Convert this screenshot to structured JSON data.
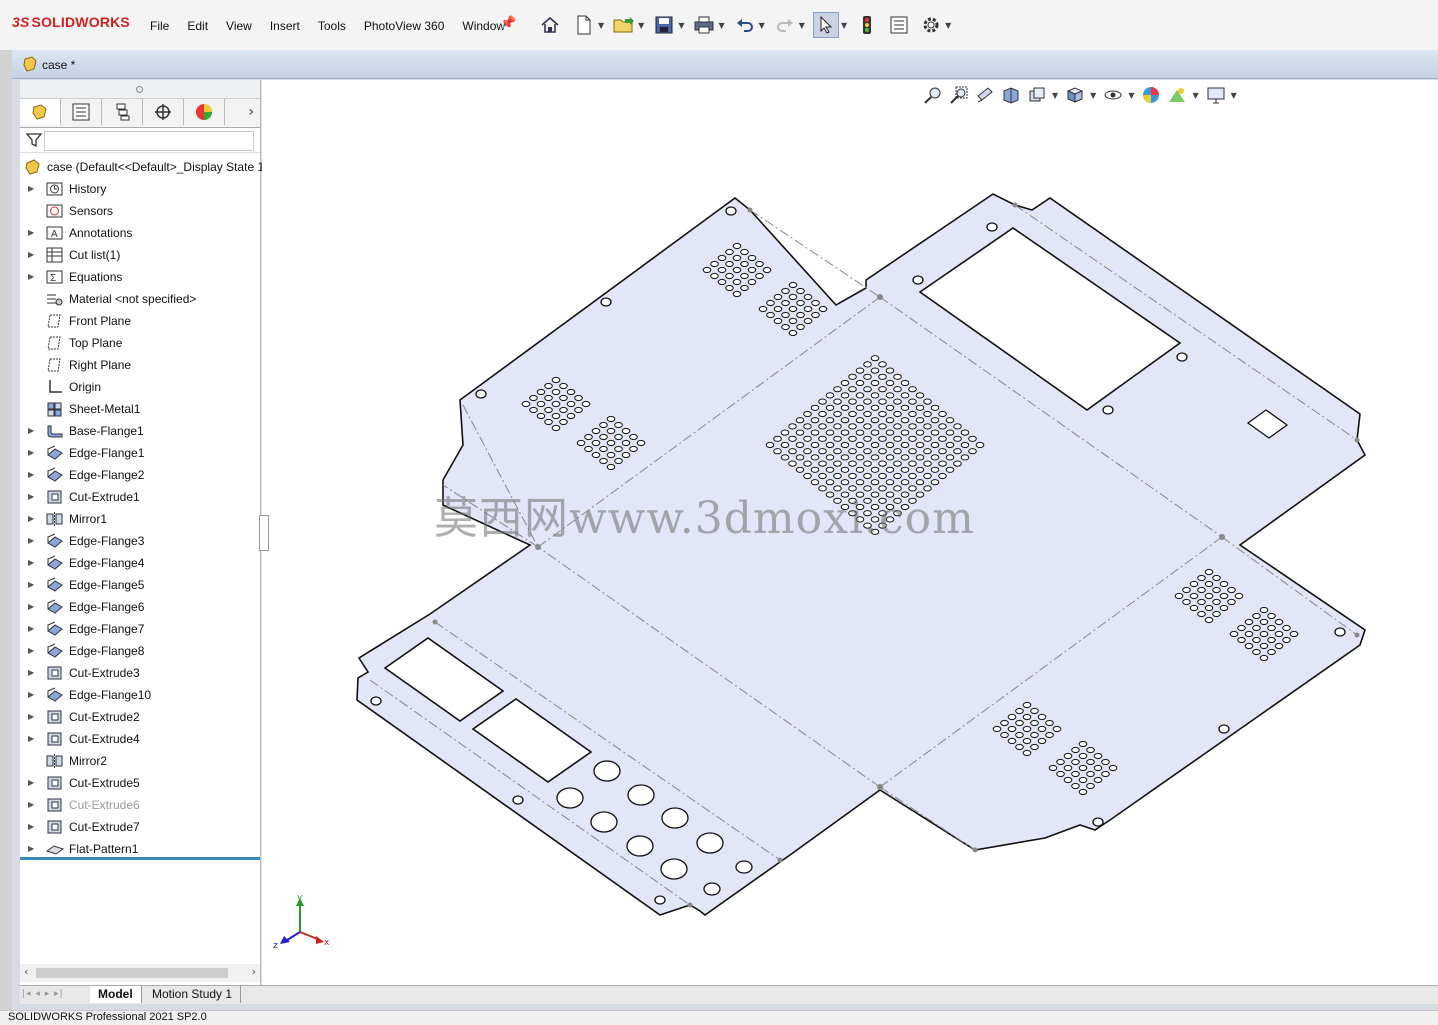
{
  "app": {
    "logo_prefix": "3S",
    "logo_name": "SOLIDWORKS"
  },
  "menu": [
    "File",
    "Edit",
    "View",
    "Insert",
    "Tools",
    "PhotoView 360",
    "Window"
  ],
  "document": {
    "title": "case *"
  },
  "tree": {
    "root_label": "case  (Default<<Default>_Display State 1",
    "items": [
      {
        "label": "History",
        "icon": "history-icon",
        "expandable": true,
        "dim": false
      },
      {
        "label": "Sensors",
        "icon": "sensor-icon",
        "expandable": false,
        "dim": false
      },
      {
        "label": "Annotations",
        "icon": "annotation-icon",
        "expandable": true,
        "dim": false
      },
      {
        "label": "Cut list(1)",
        "icon": "cutlist-icon",
        "expandable": true,
        "dim": false
      },
      {
        "label": "Equations",
        "icon": "equation-icon",
        "expandable": true,
        "dim": false
      },
      {
        "label": "Material <not specified>",
        "icon": "material-icon",
        "expandable": false,
        "dim": false
      },
      {
        "label": "Front Plane",
        "icon": "plane-icon",
        "expandable": false,
        "dim": false
      },
      {
        "label": "Top Plane",
        "icon": "plane-icon",
        "expandable": false,
        "dim": false
      },
      {
        "label": "Right Plane",
        "icon": "plane-icon",
        "expandable": false,
        "dim": false
      },
      {
        "label": "Origin",
        "icon": "origin-icon",
        "expandable": false,
        "dim": false
      },
      {
        "label": "Sheet-Metal1",
        "icon": "sheet-metal-icon",
        "expandable": false,
        "dim": false
      },
      {
        "label": "Base-Flange1",
        "icon": "base-flange-icon",
        "expandable": true,
        "dim": false
      },
      {
        "label": "Edge-Flange1",
        "icon": "edge-flange-icon",
        "expandable": true,
        "dim": false
      },
      {
        "label": "Edge-Flange2",
        "icon": "edge-flange-icon",
        "expandable": true,
        "dim": false
      },
      {
        "label": "Cut-Extrude1",
        "icon": "cut-extrude-icon",
        "expandable": true,
        "dim": false
      },
      {
        "label": "Mirror1",
        "icon": "mirror-icon",
        "expandable": true,
        "dim": false
      },
      {
        "label": "Edge-Flange3",
        "icon": "edge-flange-icon",
        "expandable": true,
        "dim": false
      },
      {
        "label": "Edge-Flange4",
        "icon": "edge-flange-icon",
        "expandable": true,
        "dim": false
      },
      {
        "label": "Edge-Flange5",
        "icon": "edge-flange-icon",
        "expandable": true,
        "dim": false
      },
      {
        "label": "Edge-Flange6",
        "icon": "edge-flange-icon",
        "expandable": true,
        "dim": false
      },
      {
        "label": "Edge-Flange7",
        "icon": "edge-flange-icon",
        "expandable": true,
        "dim": false
      },
      {
        "label": "Edge-Flange8",
        "icon": "edge-flange-icon",
        "expandable": true,
        "dim": false
      },
      {
        "label": "Cut-Extrude3",
        "icon": "cut-extrude-icon",
        "expandable": true,
        "dim": false
      },
      {
        "label": "Edge-Flange10",
        "icon": "edge-flange-icon",
        "expandable": true,
        "dim": false
      },
      {
        "label": "Cut-Extrude2",
        "icon": "cut-extrude-icon",
        "expandable": true,
        "dim": false
      },
      {
        "label": "Cut-Extrude4",
        "icon": "cut-extrude-icon",
        "expandable": true,
        "dim": false
      },
      {
        "label": "Mirror2",
        "icon": "mirror-icon",
        "expandable": false,
        "dim": false
      },
      {
        "label": "Cut-Extrude5",
        "icon": "cut-extrude-icon",
        "expandable": true,
        "dim": false
      },
      {
        "label": "Cut-Extrude6",
        "icon": "cut-extrude-icon",
        "expandable": true,
        "dim": true
      },
      {
        "label": "Cut-Extrude7",
        "icon": "cut-extrude-icon",
        "expandable": true,
        "dim": false
      },
      {
        "label": "Flat-Pattern1",
        "icon": "flat-pattern-icon",
        "expandable": true,
        "dim": false
      }
    ]
  },
  "bottom_tabs": [
    "Model",
    "Motion Study 1"
  ],
  "status": "SOLIDWORKS Professional 2021 SP2.0",
  "watermark": "莫西网www.3dmoxi.com",
  "triad": {
    "x": "x",
    "y": "y",
    "z": "z"
  },
  "colors": {
    "sheet_fill": "#e2e6f8",
    "accent": "#d21f1f",
    "selection": "#3a88b8"
  }
}
